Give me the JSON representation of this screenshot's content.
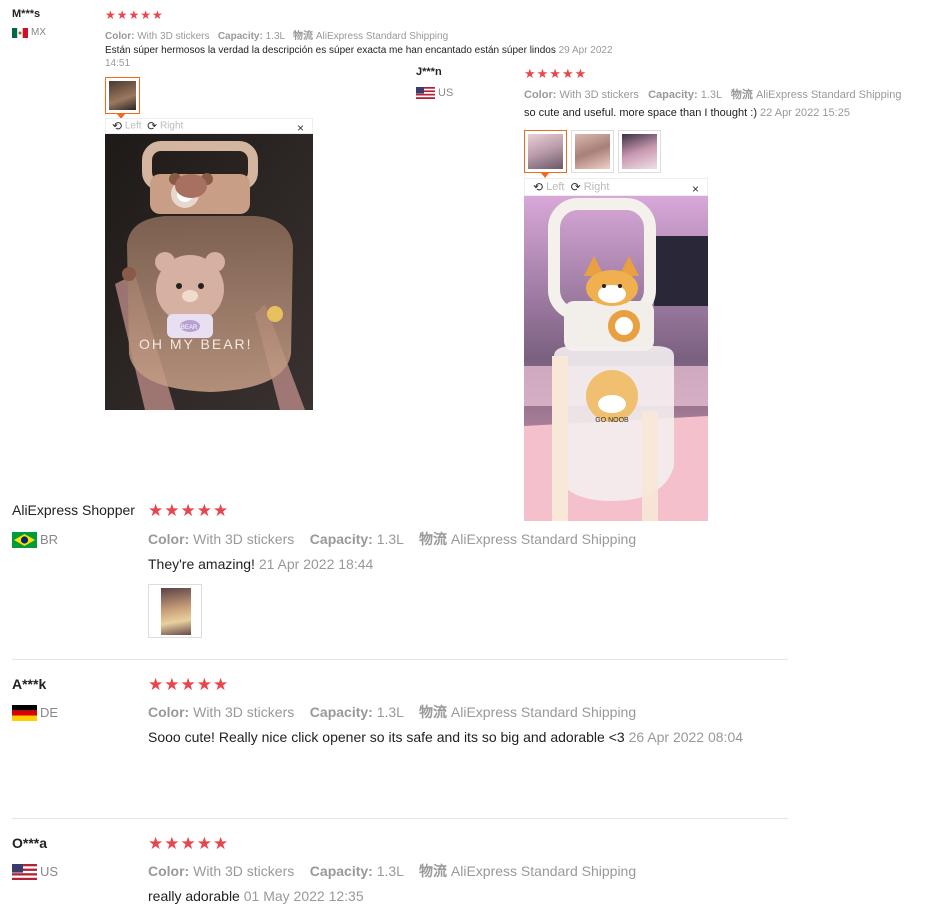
{
  "reviews": [
    {
      "name": "M***s",
      "country": "MX",
      "stars": "★★★★★",
      "color_label": "Color:",
      "color_value": "With 3D stickers",
      "capacity_label": "Capacity:",
      "capacity_value": "1.3L",
      "shipping_label": "物流",
      "shipping_value": "AliExpress Standard Shipping",
      "text": "Están súper hermosos la verdad la descripción es súper exacta me han encantado están súper lindos",
      "date_part1": "29 Apr 2022",
      "date_part2": "14:51"
    },
    {
      "name": "J***n",
      "country": "US",
      "stars": "★★★★★",
      "color_label": "Color:",
      "color_value": "With 3D stickers",
      "capacity_label": "Capacity:",
      "capacity_value": "1.3L",
      "shipping_label": "物流",
      "shipping_value": "AliExpress Standard Shipping",
      "text": "so cute and useful. more space than I thought :)",
      "date": "22 Apr 2022 15:25"
    },
    {
      "name": "AliExpress Shopper",
      "country": "BR",
      "stars": "★★★★★",
      "color_label": "Color:",
      "color_value": "With 3D stickers",
      "capacity_label": "Capacity:",
      "capacity_value": "1.3L",
      "shipping_label": "物流",
      "shipping_value": "AliExpress Standard Shipping",
      "text": "They're amazing!",
      "date": "21 Apr 2022 18:44"
    },
    {
      "name": "A***k",
      "country": "DE",
      "stars": "★★★★★",
      "color_label": "Color:",
      "color_value": "With 3D stickers",
      "capacity_label": "Capacity:",
      "capacity_value": "1.3L",
      "shipping_label": "物流",
      "shipping_value": "AliExpress Standard Shipping",
      "text": "Sooo cute! Really nice click opener so its safe and its so big and adorable <3",
      "date": "26 Apr 2022 08:04"
    },
    {
      "name": "O***a",
      "country": "US",
      "stars": "★★★★★",
      "color_label": "Color:",
      "color_value": "With 3D stickers",
      "capacity_label": "Capacity:",
      "capacity_value": "1.3L",
      "shipping_label": "物流",
      "shipping_value": "AliExpress Standard Shipping",
      "text": "really adorable",
      "date": "01 May 2022 12:35"
    }
  ],
  "viewer": {
    "left": "Left",
    "right": "Right",
    "close": "×",
    "rotate_left": "⟲",
    "rotate_right": "⟳"
  },
  "photo_texts": {
    "oh_my_bear": "OH MY BEAR!",
    "bear_badge": "BEAR",
    "go_noob": "GO NOOB"
  },
  "colors": {
    "star": "#e8464c",
    "active_thumb": "#f26a20",
    "meta": "#999999"
  }
}
